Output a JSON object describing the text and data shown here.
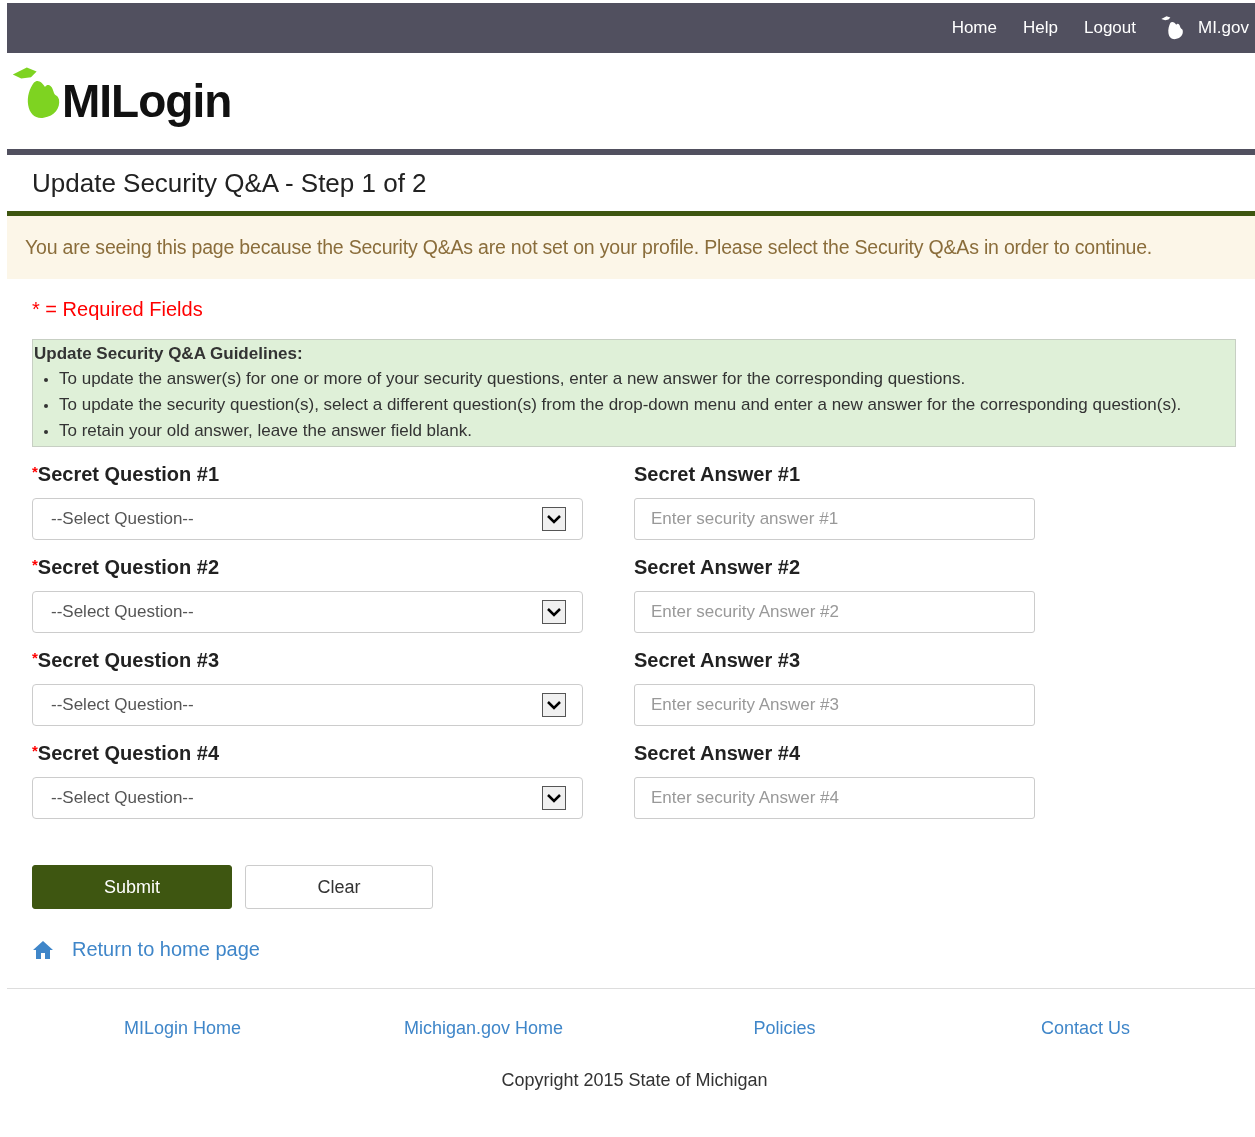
{
  "top_nav": {
    "links": [
      "Home",
      "Help",
      "Logout"
    ],
    "state_link": "MI.gov"
  },
  "logo": {
    "text": "MILogin"
  },
  "page_title": "Update Security Q&A - Step 1 of 2",
  "notice": "You are seeing this page because the Security Q&As are not set on your profile. Please select the Security Q&As in order to continue.",
  "required_note": "* = Required Fields",
  "guidelines": {
    "title": "Update Security Q&A Guidelines:",
    "items": [
      "To update the answer(s) for one or more of your security questions, enter a new answer for the corresponding questions.",
      "To update the security question(s), select a different question(s) from the drop-down menu and enter a new answer for the corresponding question(s).",
      "To retain your old answer, leave the answer field blank."
    ]
  },
  "qa_rows": [
    {
      "required_mark": "*",
      "question_label": "Secret Question #1",
      "question_value": "--Select Question--",
      "answer_label": "Secret Answer #1",
      "answer_placeholder": "Enter security answer #1"
    },
    {
      "required_mark": "*",
      "question_label": "Secret Question #2",
      "question_value": "--Select Question--",
      "answer_label": "Secret Answer #2",
      "answer_placeholder": "Enter security Answer #2"
    },
    {
      "required_mark": "*",
      "question_label": "Secret Question #3",
      "question_value": "--Select Question--",
      "answer_label": "Secret Answer #3",
      "answer_placeholder": "Enter security Answer #3"
    },
    {
      "required_mark": "*",
      "question_label": "Secret Question #4",
      "question_value": "--Select Question--",
      "answer_label": "Secret Answer #4",
      "answer_placeholder": "Enter security Answer #4"
    }
  ],
  "buttons": {
    "submit": "Submit",
    "clear": "Clear"
  },
  "return_link": "Return to home page",
  "footer": {
    "links": [
      "MILogin Home",
      "Michigan.gov Home",
      "Policies",
      "Contact Us"
    ],
    "copyright": "Copyright 2015 State of Michigan"
  }
}
